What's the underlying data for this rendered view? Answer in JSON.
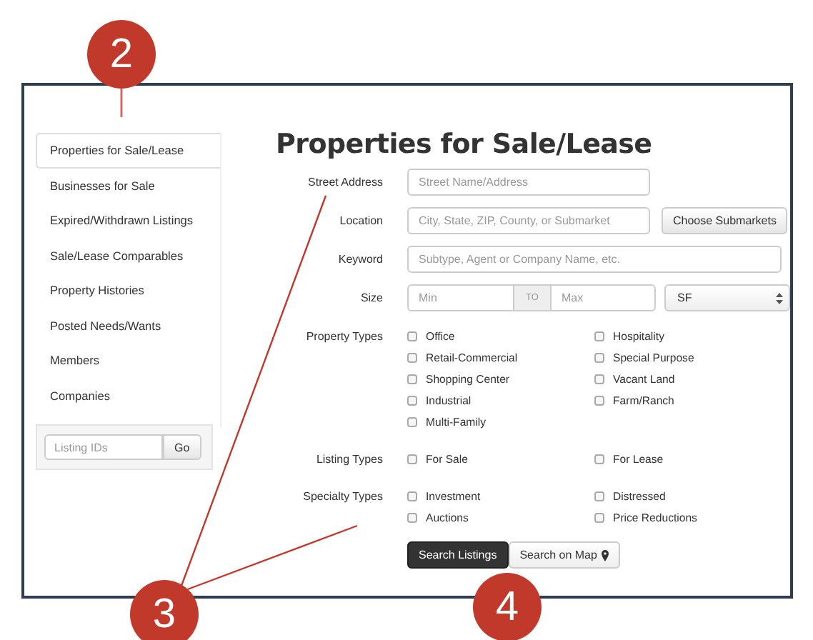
{
  "sidebar": {
    "items": [
      {
        "label": "Properties for Sale/Lease",
        "selected": true
      },
      {
        "label": "Businesses for Sale",
        "selected": false
      },
      {
        "label": "Expired/Withdrawn Listings",
        "selected": false
      },
      {
        "label": "Sale/Lease Comparables",
        "selected": false
      },
      {
        "label": "Property Histories",
        "selected": false
      },
      {
        "label": "Posted Needs/Wants",
        "selected": false
      },
      {
        "label": "Members",
        "selected": false
      },
      {
        "label": "Companies",
        "selected": false
      }
    ],
    "listing_ids": {
      "placeholder": "Listing IDs",
      "button": "Go"
    }
  },
  "heading": "Properties for Sale/Lease",
  "fields": [
    {
      "kind": "text",
      "label": "Street Address",
      "placeholder": "Street Name/Address"
    },
    {
      "kind": "text-button",
      "label": "Location",
      "placeholder": "City, State, ZIP, County, or Submarket",
      "button": "Choose Submarkets"
    },
    {
      "kind": "wide",
      "label": "Keyword",
      "placeholder": "Subtype, Agent or Company Name, etc."
    },
    {
      "kind": "range",
      "label": "Size",
      "min_placeholder": "Min",
      "separator": "TO",
      "max_placeholder": "Max",
      "unit": "SF"
    }
  ],
  "checkbox_groups": [
    {
      "label": "Property Types",
      "options": [
        {
          "label": "Office",
          "checked": false
        },
        {
          "label": "Hospitality",
          "checked": false
        },
        {
          "label": "Retail-Commercial",
          "checked": false
        },
        {
          "label": "Special Purpose",
          "checked": false
        },
        {
          "label": "Shopping Center",
          "checked": false
        },
        {
          "label": "Vacant Land",
          "checked": false
        },
        {
          "label": "Industrial",
          "checked": false
        },
        {
          "label": "Farm/Ranch",
          "checked": false
        },
        {
          "label": "Multi-Family",
          "checked": false
        }
      ]
    },
    {
      "label": "Listing Types",
      "options": [
        {
          "label": "For Sale",
          "checked": false
        },
        {
          "label": "For Lease",
          "checked": false
        }
      ]
    },
    {
      "label": "Specialty Types",
      "options": [
        {
          "label": "Investment",
          "checked": false
        },
        {
          "label": "Distressed",
          "checked": false
        },
        {
          "label": "Auctions",
          "checked": false
        },
        {
          "label": "Price Reductions",
          "checked": false
        }
      ]
    }
  ],
  "actions": [
    {
      "kind": "primary",
      "label": "Search Listings"
    },
    {
      "kind": "map",
      "label": "Search on Map"
    }
  ],
  "callouts": [
    {
      "number": "2"
    },
    {
      "number": "3"
    },
    {
      "number": "4"
    }
  ]
}
